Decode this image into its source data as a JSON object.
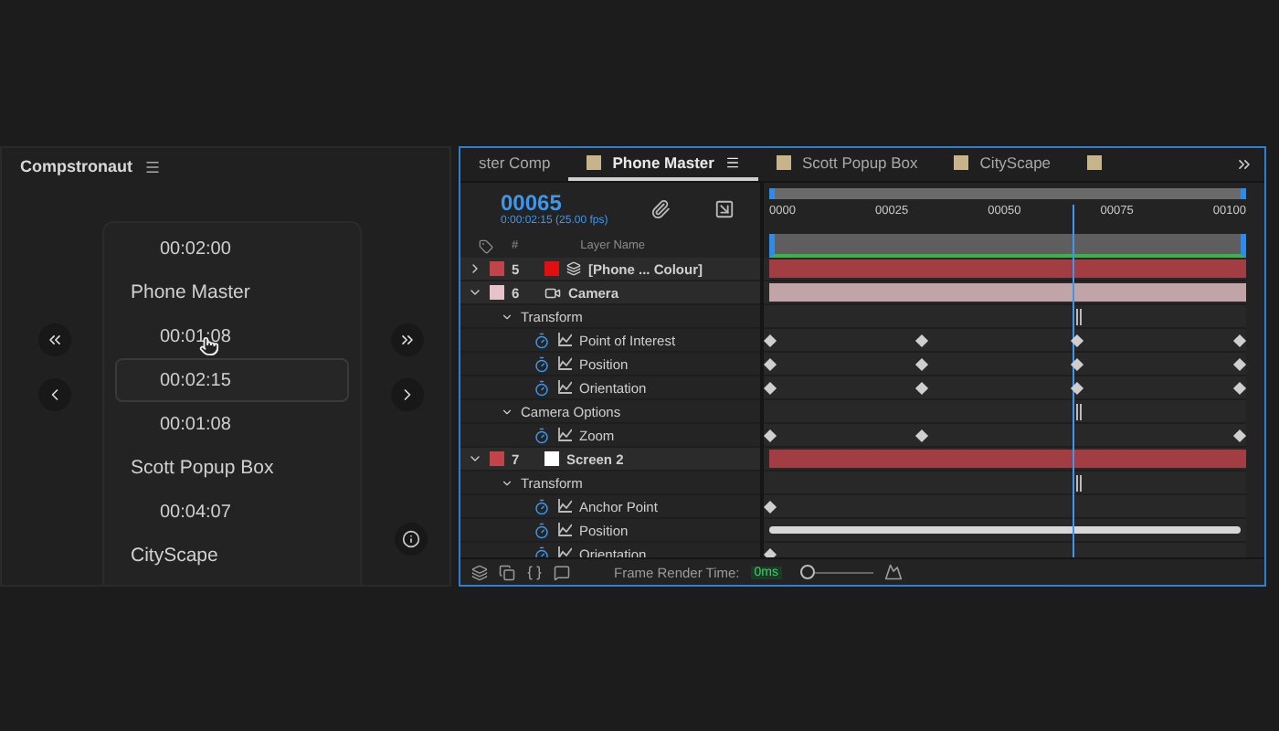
{
  "comp_panel": {
    "title": "Compstronaut",
    "items": [
      {
        "kind": "time",
        "label": "00:02:00",
        "selected": false
      },
      {
        "kind": "comp",
        "label": "Phone Master",
        "selected": false
      },
      {
        "kind": "time",
        "label": "00:01:08",
        "selected": false
      },
      {
        "kind": "time",
        "label": "00:02:15",
        "selected": true
      },
      {
        "kind": "time",
        "label": "00:01:08",
        "selected": false
      },
      {
        "kind": "comp",
        "label": "Scott Popup Box",
        "selected": false
      },
      {
        "kind": "time",
        "label": "00:04:07",
        "selected": false
      },
      {
        "kind": "comp",
        "label": "CityScape",
        "selected": false
      }
    ]
  },
  "timeline_panel": {
    "tabs": [
      {
        "label": "ster Comp",
        "selected": false
      },
      {
        "label": "Phone Master",
        "selected": true
      },
      {
        "label": "Scott Popup Box",
        "selected": false
      },
      {
        "label": "CityScape",
        "selected": false
      }
    ],
    "timecode": "00065",
    "timecode_detail": "0:00:02:15 (25.00 fps)",
    "columns": [
      "#",
      "Layer Name"
    ],
    "ruler": [
      "0000",
      "00025",
      "00050",
      "00075",
      "00100"
    ],
    "playhead": {
      "level": 0.65
    },
    "layers": [
      {
        "number": "5",
        "name": "[Phone ... Colour]",
        "kind": "precomp",
        "color": "#c0444a",
        "expanded": false
      },
      {
        "number": "6",
        "name": "Camera",
        "kind": "camera",
        "color": "#e6c3c8",
        "expanded": true,
        "children": [
          {
            "name": "Transform",
            "expanded": true,
            "children": [
              {
                "name": "Point of Interest",
                "kind": "full"
              },
              {
                "name": "Position",
                "kind": "full"
              },
              {
                "name": "Orientation",
                "kind": "full"
              }
            ]
          },
          {
            "name": "Camera Options",
            "expanded": true,
            "children": [
              {
                "name": "Zoom",
                "kind": "outer"
              }
            ]
          }
        ]
      },
      {
        "number": "7",
        "name": "Screen 2",
        "kind": "solid",
        "color": "#c0444a",
        "expanded": true,
        "children": [
          {
            "name": "Transform",
            "expanded": true,
            "children": [
              {
                "name": "Anchor Point",
                "kind": "first"
              },
              {
                "name": "Position",
                "kind": "dense"
              },
              {
                "name": "Orientation",
                "kind": "first"
              }
            ]
          }
        ]
      }
    ],
    "footer": {
      "label": "Frame Render Time:",
      "value": "0ms",
      "zoom": {
        "level": 0
      }
    }
  }
}
